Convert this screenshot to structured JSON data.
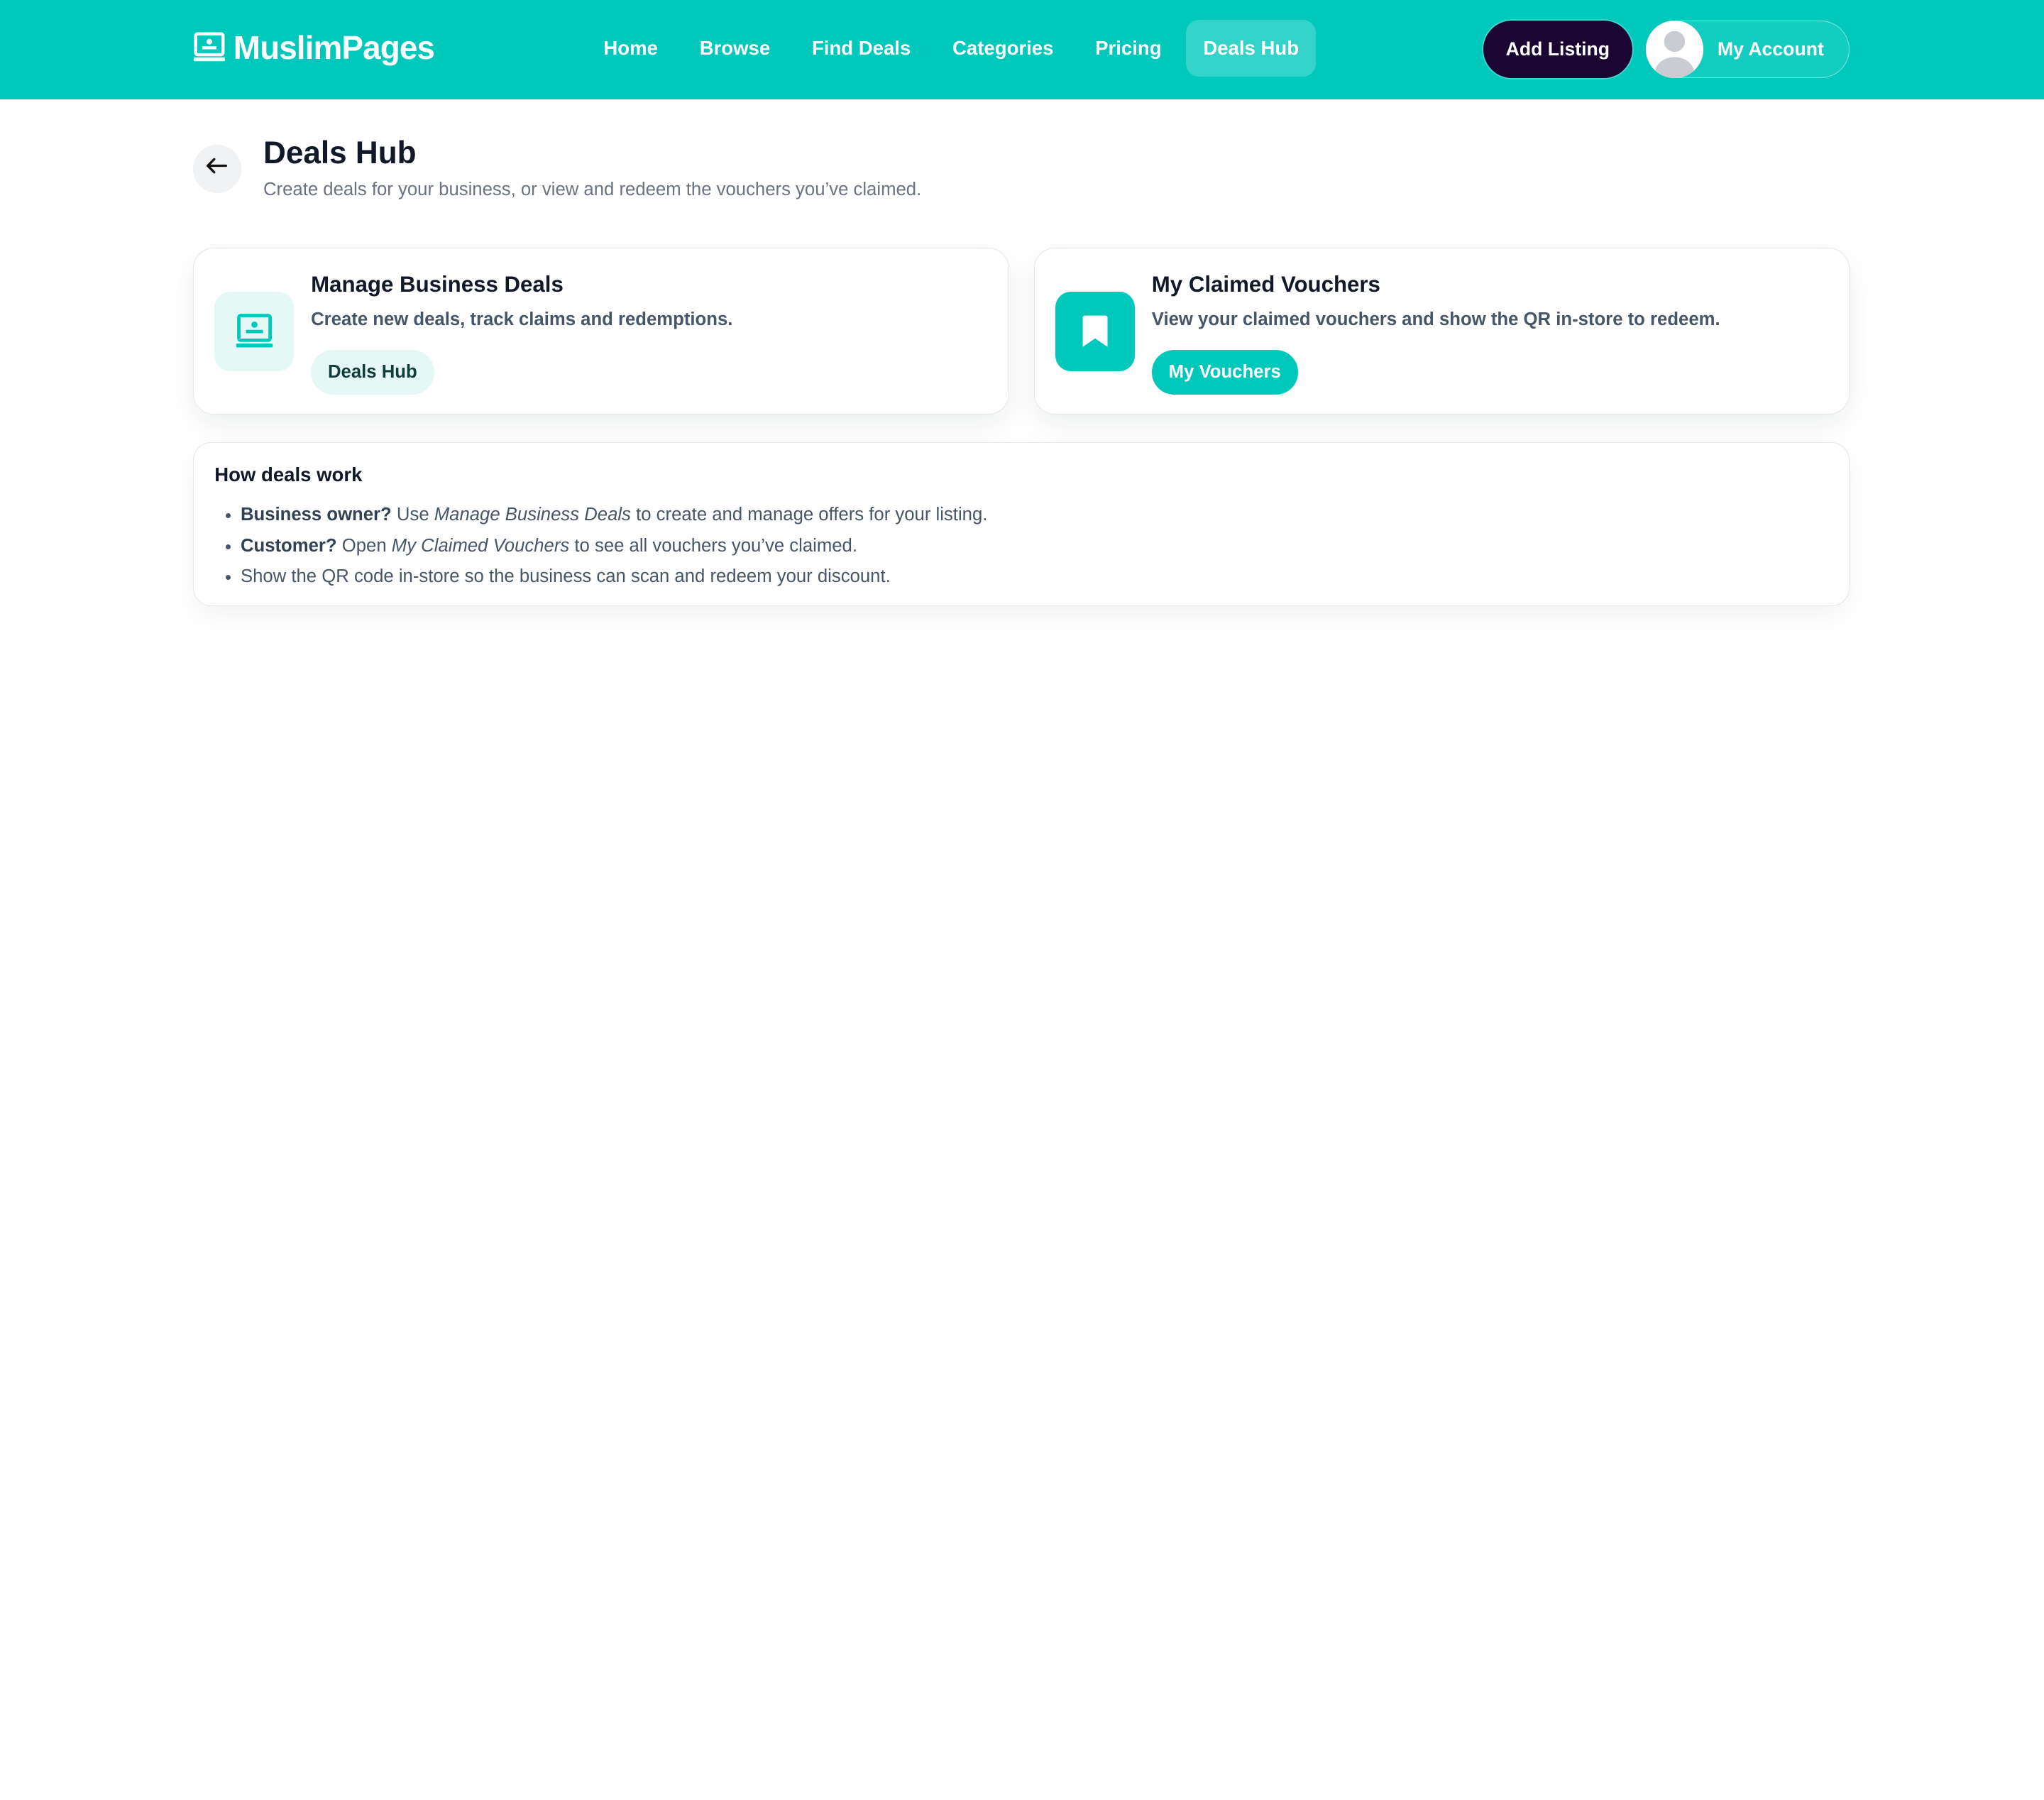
{
  "brand": {
    "name": "MuslimPages",
    "icon": "laptop-book-icon"
  },
  "nav": {
    "links": [
      {
        "label": "Home"
      },
      {
        "label": "Browse"
      },
      {
        "label": "Find Deals"
      },
      {
        "label": "Categories"
      },
      {
        "label": "Pricing"
      },
      {
        "label": "Deals Hub",
        "active": true
      }
    ],
    "add_listing": "Add Listing",
    "account": "My Account"
  },
  "page": {
    "title": "Deals Hub",
    "subtitle": "Create deals for your business, or view and redeem the vouchers you’ve claimed."
  },
  "cards": [
    {
      "title": "Manage Business Deals",
      "desc": "Create new deals, track claims and redemptions.",
      "button": "Deals Hub",
      "icon": "dashboard-icon"
    },
    {
      "title": "My Claimed Vouchers",
      "desc": "View your claimed vouchers and show the QR in-store to redeem.",
      "button": "My Vouchers",
      "icon": "bookmark-icon"
    }
  ],
  "how": {
    "title": "How deals work",
    "items": [
      {
        "lead": "Business owner?",
        "pre": " Use ",
        "em": "Manage Business Deals",
        "post": " to create and manage offers for your listing."
      },
      {
        "lead": "Customer?",
        "pre": " Open ",
        "em": "My Claimed Vouchers",
        "post": " to see all vouchers you’ve claimed."
      },
      {
        "text": "Show the QR code in-store so the business can scan and redeem your discount."
      }
    ]
  },
  "colors": {
    "brand": "#00c9bc",
    "dark": "#1a0533",
    "soft": "#e6f8f6"
  }
}
